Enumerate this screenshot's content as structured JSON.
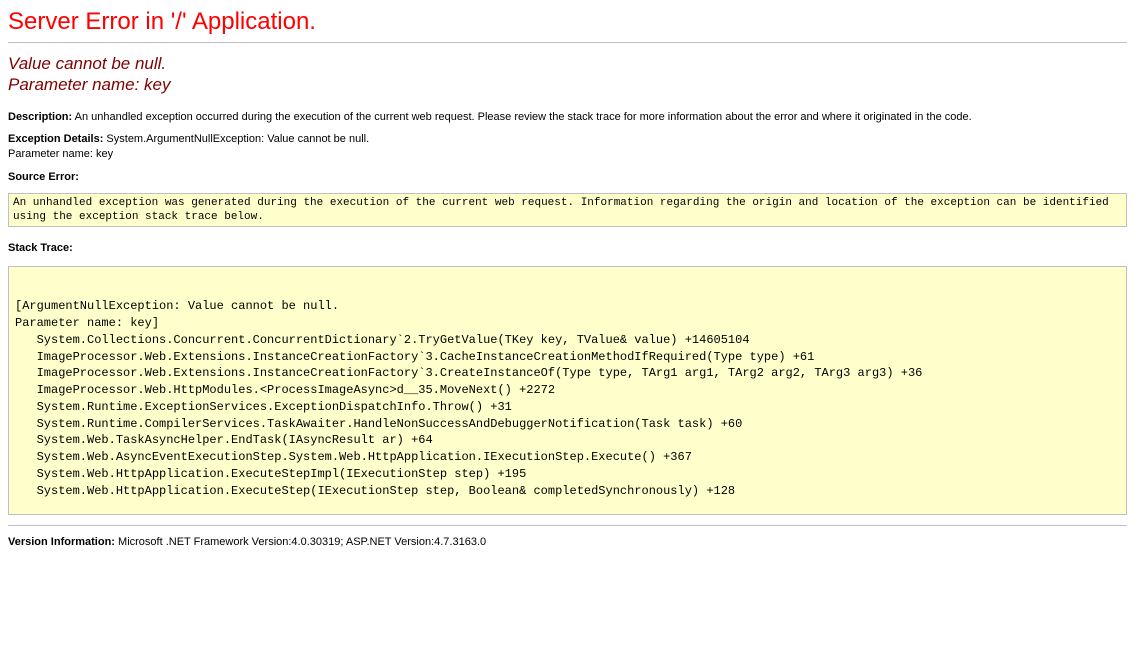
{
  "header": {
    "title": "Server Error in '/' Application."
  },
  "error": {
    "message": "Value cannot be null.\nParameter name: key"
  },
  "description": {
    "label": "Description:",
    "text": "An unhandled exception occurred during the execution of the current web request. Please review the stack trace for more information about the error and where it originated in the code."
  },
  "exception": {
    "label": "Exception Details:",
    "text": "System.ArgumentNullException: Value cannot be null.\nParameter name: key"
  },
  "sourceError": {
    "label": "Source Error:",
    "box": "An unhandled exception was generated during the execution of the current web request. Information regarding the origin and location of the exception can be identified using the exception stack trace below."
  },
  "stackTrace": {
    "label": "Stack Trace:",
    "box": "\n[ArgumentNullException: Value cannot be null.\nParameter name: key]\n   System.Collections.Concurrent.ConcurrentDictionary`2.TryGetValue(TKey key, TValue& value) +14605104\n   ImageProcessor.Web.Extensions.InstanceCreationFactory`3.CacheInstanceCreationMethodIfRequired(Type type) +61\n   ImageProcessor.Web.Extensions.InstanceCreationFactory`3.CreateInstanceOf(Type type, TArg1 arg1, TArg2 arg2, TArg3 arg3) +36\n   ImageProcessor.Web.HttpModules.<ProcessImageAsync>d__35.MoveNext() +2272\n   System.Runtime.ExceptionServices.ExceptionDispatchInfo.Throw() +31\n   System.Runtime.CompilerServices.TaskAwaiter.HandleNonSuccessAndDebuggerNotification(Task task) +60\n   System.Web.TaskAsyncHelper.EndTask(IAsyncResult ar) +64\n   System.Web.AsyncEventExecutionStep.System.Web.HttpApplication.IExecutionStep.Execute() +367\n   System.Web.HttpApplication.ExecuteStepImpl(IExecutionStep step) +195\n   System.Web.HttpApplication.ExecuteStep(IExecutionStep step, Boolean& completedSynchronously) +128\n"
  },
  "version": {
    "label": "Version Information:",
    "text": "Microsoft .NET Framework Version:4.0.30319; ASP.NET Version:4.7.3163.0"
  }
}
